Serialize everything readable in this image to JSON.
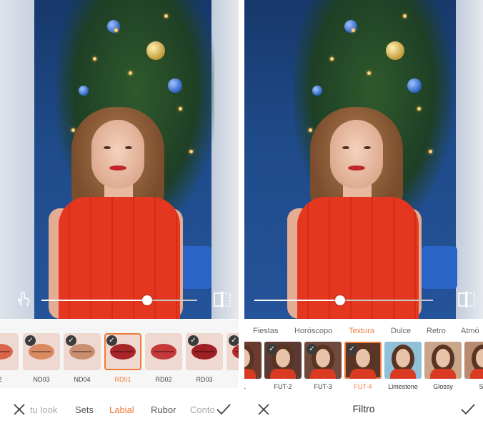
{
  "colors": {
    "accent": "#ef7b3a",
    "text": "#555555"
  },
  "left": {
    "lip_thumbs": [
      {
        "label": "2",
        "color": "#d9664a",
        "checked": false,
        "selected": false
      },
      {
        "label": "ND03",
        "color": "#d98a63",
        "checked": true,
        "selected": false
      },
      {
        "label": "ND04",
        "color": "#c98f70",
        "checked": true,
        "selected": false
      },
      {
        "label": "RD01",
        "color": "#a8262a",
        "checked": true,
        "selected": true
      },
      {
        "label": "RD02",
        "color": "#c5393a",
        "checked": false,
        "selected": false
      },
      {
        "label": "RD03",
        "color": "#9e1f24",
        "checked": true,
        "selected": false
      },
      {
        "label": "R",
        "color": "#b12a2c",
        "checked": true,
        "selected": false
      }
    ],
    "categories": [
      {
        "label": "tu look",
        "active": false
      },
      {
        "label": "Sets",
        "active": false
      },
      {
        "label": "Labial",
        "active": true
      },
      {
        "label": "Rubor",
        "active": false
      },
      {
        "label": "Conto",
        "active": false
      }
    ],
    "slider_value": 0.68,
    "icons": {
      "close": "close-icon",
      "confirm": "checkmark-icon",
      "hand": "hand-touch-icon",
      "compare": "compare-icon"
    }
  },
  "right": {
    "filter_categories": [
      {
        "label": "Fiestas",
        "active": false
      },
      {
        "label": "Horóscopo",
        "active": false
      },
      {
        "label": "Textura",
        "active": true
      },
      {
        "label": "Dulce",
        "active": false
      },
      {
        "label": "Retro",
        "active": false
      },
      {
        "label": "Atmó",
        "active": false
      }
    ],
    "filters": [
      {
        "label": "-1",
        "tone": "#6b3b30",
        "checked": false,
        "selected": false
      },
      {
        "label": "FUT-2",
        "tone": "#5c3a33",
        "checked": true,
        "selected": false
      },
      {
        "label": "FUT-3",
        "tone": "#6f4a3c",
        "checked": true,
        "selected": false
      },
      {
        "label": "FUT-4",
        "tone": "#5a3528",
        "checked": true,
        "selected": true
      },
      {
        "label": "Limestone",
        "tone": "#8fc0d8",
        "checked": false,
        "selected": false
      },
      {
        "label": "Glossy",
        "tone": "#c9a58a",
        "checked": false,
        "selected": false
      },
      {
        "label": "Se",
        "tone": "#b88b70",
        "checked": false,
        "selected": false
      }
    ],
    "title": "Filtro",
    "slider_value": 0.48,
    "icons": {
      "close": "close-icon",
      "confirm": "checkmark-icon",
      "compare": "compare-icon"
    }
  }
}
